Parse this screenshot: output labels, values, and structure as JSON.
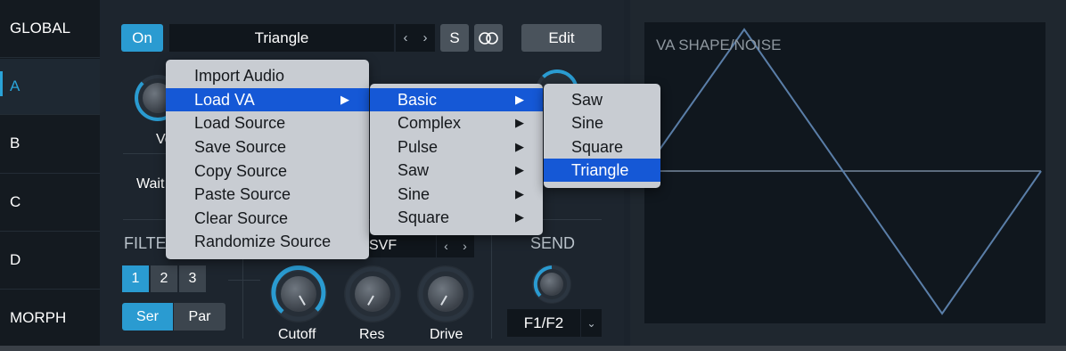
{
  "sidebar": {
    "items": [
      {
        "label": "GLOBAL"
      },
      {
        "label": "A"
      },
      {
        "label": "B"
      },
      {
        "label": "C"
      },
      {
        "label": "D"
      },
      {
        "label": "MORPH"
      }
    ],
    "active": "A"
  },
  "toolbar": {
    "on_label": "On",
    "source_name": "Triangle",
    "prev_icon": "‹",
    "next_icon": "›",
    "solo_label": "S",
    "link_icon": "linked-circles-icon",
    "edit_label": "Edit"
  },
  "source_section": {
    "volume_label_partial": "Vo",
    "wait_label_partial": "Wait"
  },
  "filter": {
    "title_partial": "FILTE",
    "filters": [
      "1",
      "2",
      "3"
    ],
    "selected_filter": "1",
    "routing": [
      "Ser",
      "Par"
    ],
    "selected_routing": "Ser",
    "type_value": "SVF",
    "knobs": [
      {
        "label": "Cutoff"
      },
      {
        "label": "Res"
      },
      {
        "label": "Drive"
      }
    ]
  },
  "send": {
    "title": "SEND",
    "target": "F1/F2"
  },
  "display": {
    "title": "VA SHAPE/NOISE"
  },
  "menu": {
    "items": [
      {
        "label": "Import Audio"
      },
      {
        "label": "Load VA",
        "submenu": true
      },
      {
        "label": "Load Source"
      },
      {
        "label": "Save Source"
      },
      {
        "label": "Copy Source"
      },
      {
        "label": "Paste Source"
      },
      {
        "label": "Clear Source"
      },
      {
        "label": "Randomize Source"
      }
    ],
    "highlighted": "Load VA",
    "submenu_arrow": "▶"
  },
  "va_submenu": {
    "items": [
      {
        "label": "Basic",
        "submenu": true
      },
      {
        "label": "Complex",
        "submenu": true
      },
      {
        "label": "Pulse",
        "submenu": true
      },
      {
        "label": "Saw",
        "submenu": true
      },
      {
        "label": "Sine",
        "submenu": true
      },
      {
        "label": "Square",
        "submenu": true
      }
    ],
    "highlighted": "Basic"
  },
  "basic_submenu": {
    "items": [
      {
        "label": "Saw"
      },
      {
        "label": "Sine"
      },
      {
        "label": "Square"
      },
      {
        "label": "Triangle"
      }
    ],
    "highlighted": "Triangle"
  },
  "colors": {
    "accent": "#2a9bd1",
    "menu_highlight": "#1558d6",
    "menu_bg": "#c8ccd2",
    "waveform": "#5a7ea8"
  }
}
